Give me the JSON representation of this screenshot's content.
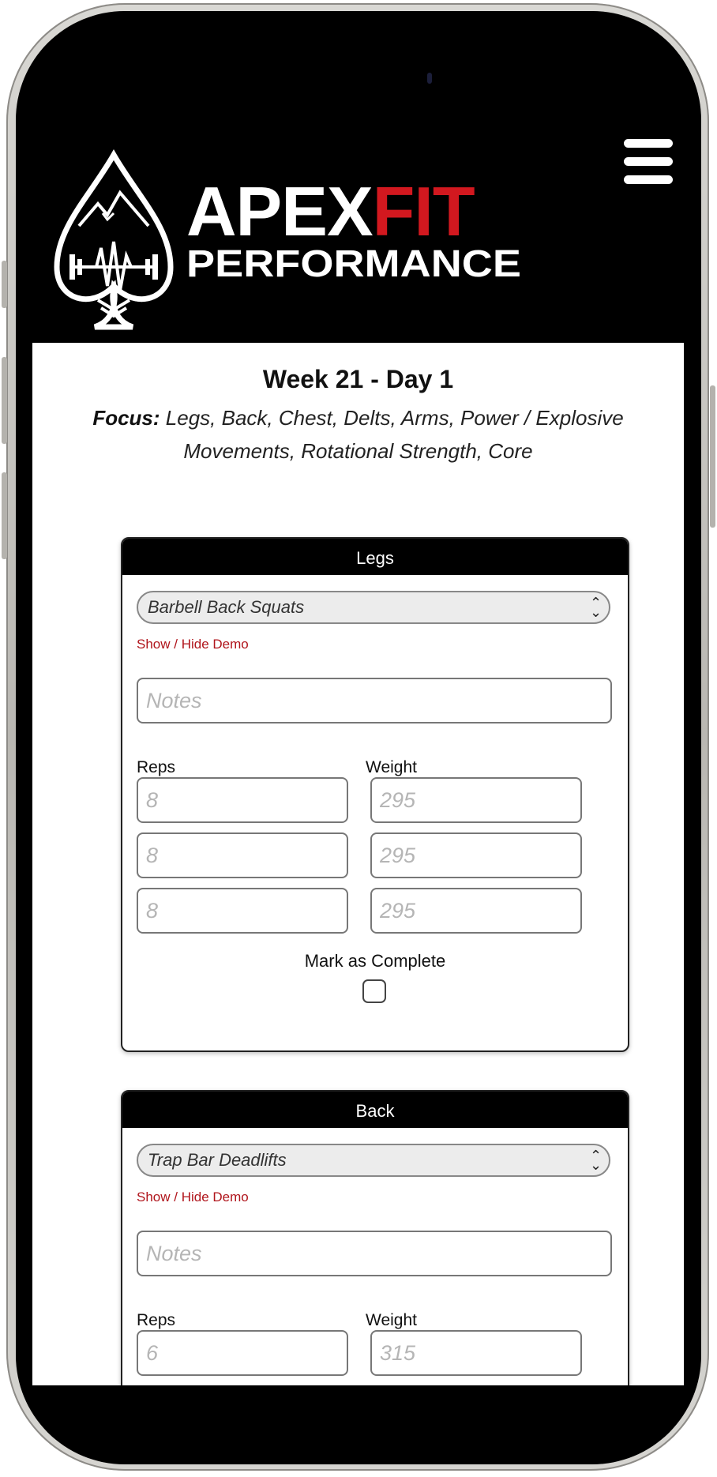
{
  "header": {
    "brand": {
      "word_apex": "APEX",
      "word_fit": "FIT",
      "word_performance": "PERFORMANCE"
    },
    "colors": {
      "background": "#000000",
      "brand_white": "#ffffff",
      "brand_red": "#d2181f"
    },
    "menu_icon": "hamburger-menu-icon"
  },
  "page": {
    "title": "Week 21 - Day 1",
    "focus_label": "Focus:",
    "focus_text": " Legs, Back, Chest, Delts, Arms, Power / Explosive Movements, Rotational Strength, Core"
  },
  "cards": [
    {
      "header": "Legs",
      "exercise": "Barbell Back Squats",
      "demo_link": "Show / Hide Demo",
      "notes_placeholder": "Notes",
      "reps_label": "Reps",
      "weight_label": "Weight",
      "sets": [
        {
          "reps": "8",
          "weight": "295"
        },
        {
          "reps": "8",
          "weight": "295"
        },
        {
          "reps": "8",
          "weight": "295"
        }
      ],
      "complete_label": "Mark as Complete",
      "completed": false
    },
    {
      "header": "Back",
      "exercise": "Trap Bar Deadlifts",
      "demo_link": "Show / Hide Demo",
      "notes_placeholder": "Notes",
      "reps_label": "Reps",
      "weight_label": "Weight",
      "sets": [
        {
          "reps": "6",
          "weight": "315"
        }
      ]
    }
  ],
  "colors": {
    "link_red": "#b0141b",
    "card_header": "#000000"
  }
}
